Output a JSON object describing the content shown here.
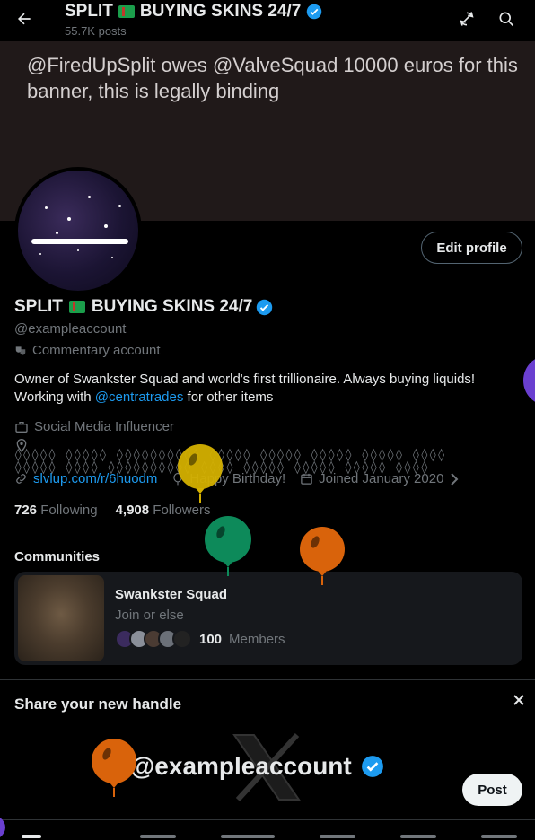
{
  "header": {
    "title": "SPLIT",
    "title_suffix": "BUYING SKINS 24/7",
    "post_count": "55.7K posts"
  },
  "banner": {
    "text": "@FiredUpSplit owes @ValveSquad 10000 euros for this banner, this is legally binding"
  },
  "profile": {
    "edit_label": "Edit profile",
    "name": "SPLIT",
    "name_suffix": "BUYING SKINS 24/7",
    "handle": "@exampleaccount",
    "category": "Commentary account",
    "bio_prefix": "Owner of Swankster Squad and world's first trillionaire. Always buying liquids! Working with ",
    "bio_link": "@centratrades",
    "bio_suffix": " for other items",
    "profession": "Social Media Influencer",
    "location_line1": "◊◊◊◊◊ ◊◊◊◊◊ ◊◊◊◊◊◊◊◊◊◊ ◊◊◊◊◊ ◊◊◊◊◊ ◊◊◊◊◊ ◊◊◊◊◊ ◊◊◊◊",
    "location_line2": "◊◊◊◊◊ ◊◊◊◊ ◊◊◊◊◊◊◊◊◊◊ ◊◊◊◊ ◊◊◊◊◊ ◊◊◊◊◊ ◊◊◊◊◊ ◊◊◊◊",
    "website": "slvlup.com/r/6huodm",
    "birthday": "Happy Birthday!",
    "joined": "Joined January 2020",
    "following_count": "726",
    "following_label": "Following",
    "followers_count": "4,908",
    "followers_label": "Followers"
  },
  "communities": {
    "title": "Communities",
    "name": "Swankster Squad",
    "description": "Join or else",
    "member_count": "100",
    "member_label": "Members"
  },
  "share": {
    "title": "Share your new handle",
    "handle": "@exampleaccount",
    "post_label": "Post"
  },
  "colors": {
    "accent": "#1d9bf0",
    "balloon_yellow": "#d4b000",
    "balloon_green": "#0d8a5a",
    "balloon_orange": "#d9630b",
    "balloon_purple": "#6a3fd0"
  }
}
